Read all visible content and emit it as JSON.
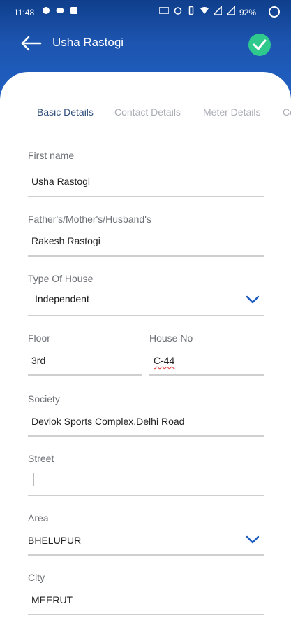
{
  "status_bar": {
    "time": "11:48",
    "battery": "92%"
  },
  "appbar": {
    "title": "Usha Rastogi",
    "back_icon": "arrow-left-icon",
    "confirm_icon": "check-icon",
    "confirm_color": "#2fc98d"
  },
  "tabs": [
    {
      "label": "Basic Details",
      "active": true
    },
    {
      "label": "Contact Details",
      "active": false
    },
    {
      "label": "Meter Details",
      "active": false
    },
    {
      "label": "Co",
      "active": false
    }
  ],
  "form": {
    "first_name": {
      "label": "First name",
      "value": "Usha Rastogi"
    },
    "guardian": {
      "label": "Father's/Mother's/Husband's",
      "value": "Rakesh Rastogi"
    },
    "house_type": {
      "label": "Type Of House",
      "value": "Independent"
    },
    "floor": {
      "label": "Floor",
      "value": "3rd"
    },
    "house_no": {
      "label": "House No",
      "value": "C-44"
    },
    "society": {
      "label": "Society",
      "value": "Devlok Sports Complex,Delhi Road"
    },
    "street": {
      "label": "Street",
      "value": ""
    },
    "area": {
      "label": "Area",
      "value": "BHELUPUR"
    },
    "city": {
      "label": "City",
      "value": "MEERUT"
    }
  },
  "colors": {
    "header_blue": "#1d55b0",
    "active_tab": "#2d4d7a",
    "chevron": "#1d5bbf"
  }
}
